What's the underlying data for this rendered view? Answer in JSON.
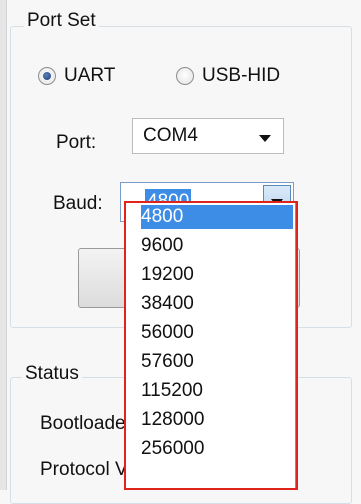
{
  "port_set": {
    "title": "Port Set",
    "mode_options": [
      {
        "label": "UART",
        "selected": true
      },
      {
        "label": "USB-HID",
        "selected": false
      }
    ],
    "port": {
      "label": "Port:",
      "value": "COM4"
    },
    "baud": {
      "label": "Baud:",
      "value": "4800",
      "options": [
        "4800",
        "9600",
        "19200",
        "38400",
        "56000",
        "57600",
        "115200",
        "128000",
        "256000"
      ],
      "selected_option": "4800"
    }
  },
  "status": {
    "title": "Status",
    "bootloader_label": "Bootloade",
    "protocol_label": "Protocol V"
  },
  "colors": {
    "selection": "#3d8ce6",
    "highlight_box": "#e0241c"
  }
}
